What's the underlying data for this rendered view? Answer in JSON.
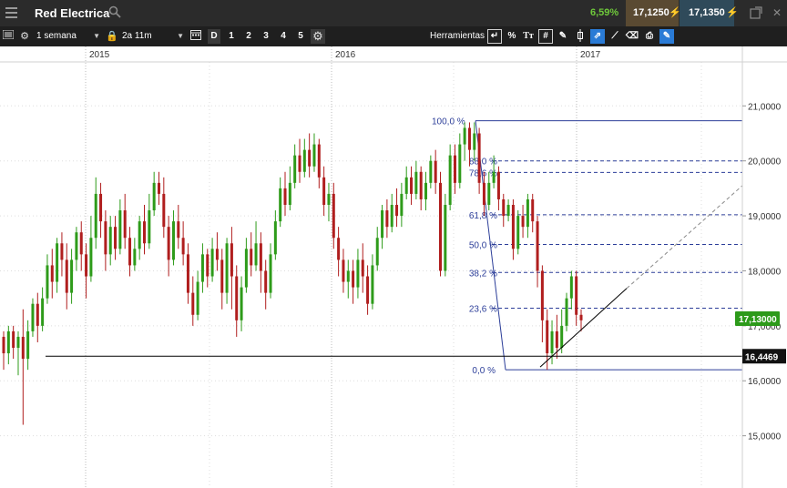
{
  "window": {
    "symbol": "Red Electrica",
    "change_pct": "6,59%",
    "bid": "17,1250",
    "ask": "17,1350"
  },
  "toolbar": {
    "interval": "1 semana",
    "range": "2a 11m",
    "period_buttons": [
      "D",
      "1",
      "2",
      "3",
      "4",
      "5"
    ],
    "tools_label": "Herramientas",
    "pct_tool": "%"
  },
  "chart_data": {
    "type": "candlestick",
    "x_labels": [
      "2015",
      "2016",
      "2017"
    ],
    "y_ticks": [
      "21,0000",
      "20,0000",
      "19,0000",
      "18,0000",
      "17,0000",
      "16,0000",
      "15,0000"
    ],
    "y_tick_values": [
      21,
      20,
      19,
      18,
      17,
      16,
      15
    ],
    "ylim": [
      14.05,
      21.8
    ],
    "current_price": "17,13000",
    "horizontal_line_value": "16,4469",
    "fibonacci": {
      "high": 20.73,
      "low": 16.2,
      "levels": [
        {
          "label": "100,0 %",
          "value": 20.73
        },
        {
          "label": "88,0 %",
          "value": 20.0
        },
        {
          "label": "78,6 %",
          "value": 19.79
        },
        {
          "label": "61,8 %",
          "value": 19.02
        },
        {
          "label": "50,0 %",
          "value": 18.48
        },
        {
          "label": "38,2 %",
          "value": 17.97
        },
        {
          "label": "23,6 %",
          "value": 17.32
        },
        {
          "label": "0,0 %",
          "value": 16.2
        }
      ]
    },
    "trendline": {
      "from": 16.25,
      "to": 17.68,
      "extension_to": 19.55
    },
    "candles": [
      [
        16.8,
        16.5,
        16.9,
        16.2
      ],
      [
        16.5,
        16.9,
        17.0,
        16.3
      ],
      [
        16.9,
        16.6,
        17.0,
        16.4
      ],
      [
        16.6,
        16.8,
        16.9,
        16.1
      ],
      [
        16.8,
        16.4,
        17.3,
        15.2
      ],
      [
        16.4,
        16.9,
        17.1,
        16.2
      ],
      [
        16.9,
        17.4,
        17.5,
        16.8
      ],
      [
        17.4,
        17.0,
        17.6,
        16.7
      ],
      [
        17.0,
        17.5,
        17.7,
        16.9
      ],
      [
        17.5,
        18.1,
        18.3,
        17.4
      ],
      [
        18.1,
        17.8,
        18.4,
        17.5
      ],
      [
        17.8,
        18.5,
        18.6,
        17.6
      ],
      [
        18.5,
        18.2,
        18.7,
        17.9
      ],
      [
        18.2,
        17.6,
        18.5,
        17.3
      ],
      [
        17.6,
        18.2,
        18.4,
        17.4
      ],
      [
        18.2,
        18.7,
        18.8,
        18.0
      ],
      [
        18.7,
        18.3,
        18.9,
        18.0
      ],
      [
        18.3,
        17.9,
        18.5,
        17.5
      ],
      [
        17.9,
        18.6,
        19.0,
        17.8
      ],
      [
        18.6,
        19.4,
        19.7,
        18.4
      ],
      [
        19.4,
        18.9,
        19.6,
        18.6
      ],
      [
        18.9,
        18.3,
        19.1,
        18.0
      ],
      [
        18.3,
        18.8,
        19.0,
        18.1
      ],
      [
        18.8,
        18.4,
        19.0,
        18.2
      ],
      [
        18.4,
        19.1,
        19.3,
        18.3
      ],
      [
        19.1,
        18.6,
        19.4,
        18.4
      ],
      [
        18.6,
        18.1,
        18.8,
        17.9
      ],
      [
        18.1,
        18.4,
        18.6,
        18.0
      ],
      [
        18.4,
        18.9,
        19.0,
        18.2
      ],
      [
        18.9,
        18.5,
        19.2,
        18.3
      ],
      [
        18.5,
        19.1,
        19.4,
        18.4
      ],
      [
        19.1,
        19.6,
        19.8,
        19.0
      ],
      [
        19.6,
        19.4,
        19.8,
        19.2
      ],
      [
        19.4,
        18.8,
        19.7,
        18.6
      ],
      [
        18.8,
        18.2,
        19.0,
        17.9
      ],
      [
        18.2,
        18.9,
        19.1,
        18.1
      ],
      [
        18.9,
        18.6,
        19.2,
        18.4
      ],
      [
        18.6,
        18.3,
        18.9,
        18.1
      ],
      [
        18.3,
        17.6,
        18.5,
        17.4
      ],
      [
        17.6,
        17.2,
        17.9,
        17.0
      ],
      [
        17.2,
        17.8,
        18.0,
        17.1
      ],
      [
        17.8,
        18.3,
        18.5,
        17.6
      ],
      [
        18.3,
        17.9,
        18.4,
        17.7
      ],
      [
        17.9,
        18.4,
        18.6,
        17.8
      ],
      [
        18.4,
        18.2,
        18.7,
        18.0
      ],
      [
        18.2,
        17.6,
        18.4,
        17.3
      ],
      [
        17.6,
        18.5,
        18.6,
        17.4
      ],
      [
        18.5,
        17.9,
        18.8,
        17.3
      ],
      [
        17.9,
        17.1,
        18.1,
        16.8
      ],
      [
        17.1,
        17.7,
        17.9,
        16.9
      ],
      [
        17.7,
        18.4,
        18.6,
        17.6
      ],
      [
        18.4,
        18.1,
        18.7,
        17.9
      ],
      [
        18.1,
        18.5,
        18.9,
        18.0
      ],
      [
        18.5,
        18.0,
        18.7,
        17.6
      ],
      [
        18.0,
        17.6,
        18.2,
        17.3
      ],
      [
        17.6,
        18.3,
        18.5,
        17.5
      ],
      [
        18.3,
        18.9,
        19.1,
        18.2
      ],
      [
        18.9,
        19.5,
        19.7,
        18.8
      ],
      [
        19.5,
        19.2,
        19.8,
        19.0
      ],
      [
        19.2,
        19.6,
        19.9,
        19.1
      ],
      [
        19.6,
        20.1,
        20.3,
        19.5
      ],
      [
        20.1,
        19.8,
        20.4,
        19.6
      ],
      [
        19.8,
        20.2,
        20.4,
        19.7
      ],
      [
        20.2,
        19.9,
        20.5,
        19.7
      ],
      [
        19.9,
        20.3,
        20.5,
        19.8
      ],
      [
        20.3,
        19.7,
        20.4,
        19.5
      ],
      [
        19.7,
        19.2,
        19.9,
        19.0
      ],
      [
        19.2,
        19.4,
        19.6,
        18.9
      ],
      [
        19.4,
        18.6,
        19.6,
        18.4
      ],
      [
        18.6,
        18.2,
        18.8,
        17.9
      ],
      [
        18.2,
        17.8,
        18.4,
        17.6
      ],
      [
        17.8,
        18.0,
        18.2,
        17.5
      ],
      [
        18.0,
        17.7,
        18.2,
        17.4
      ],
      [
        17.7,
        18.2,
        18.4,
        17.5
      ],
      [
        18.2,
        17.9,
        18.5,
        17.6
      ],
      [
        17.9,
        17.4,
        18.1,
        17.2
      ],
      [
        17.4,
        18.1,
        18.3,
        17.3
      ],
      [
        18.1,
        18.6,
        18.8,
        18.0
      ],
      [
        18.6,
        19.1,
        19.2,
        18.4
      ],
      [
        19.1,
        18.8,
        19.3,
        18.6
      ],
      [
        18.8,
        19.2,
        19.4,
        18.7
      ],
      [
        19.2,
        19.0,
        19.5,
        18.8
      ],
      [
        19.0,
        19.4,
        19.6,
        18.8
      ],
      [
        19.4,
        19.7,
        19.9,
        19.3
      ],
      [
        19.7,
        19.4,
        19.9,
        19.2
      ],
      [
        19.4,
        19.8,
        20.0,
        19.3
      ],
      [
        19.8,
        19.3,
        19.9,
        19.1
      ],
      [
        19.3,
        19.6,
        19.8,
        19.1
      ],
      [
        19.6,
        20.0,
        20.1,
        19.5
      ],
      [
        20.0,
        19.6,
        20.2,
        19.4
      ],
      [
        19.6,
        18.0,
        19.8,
        17.9
      ],
      [
        18.0,
        19.2,
        19.4,
        17.9
      ],
      [
        19.2,
        20.1,
        20.3,
        19.1
      ],
      [
        20.1,
        19.6,
        20.3,
        19.4
      ],
      [
        19.6,
        20.3,
        20.5,
        19.5
      ],
      [
        20.3,
        20.6,
        20.7,
        20.0
      ],
      [
        20.6,
        20.2,
        20.7,
        19.9
      ],
      [
        20.2,
        20.5,
        20.7,
        20.0
      ],
      [
        20.5,
        19.6,
        20.6,
        19.4
      ],
      [
        19.6,
        19.2,
        19.8,
        19.0
      ],
      [
        19.2,
        19.6,
        19.8,
        19.1
      ],
      [
        19.6,
        19.8,
        20.1,
        19.5
      ],
      [
        19.8,
        19.3,
        19.9,
        19.1
      ],
      [
        19.3,
        19.0,
        19.4,
        18.8
      ],
      [
        19.0,
        19.2,
        19.3,
        18.9
      ],
      [
        19.2,
        18.4,
        19.3,
        18.2
      ],
      [
        18.4,
        19.0,
        19.1,
        18.3
      ],
      [
        19.0,
        18.8,
        19.2,
        18.6
      ],
      [
        18.8,
        19.3,
        19.4,
        18.6
      ],
      [
        19.3,
        18.9,
        19.4,
        18.7
      ],
      [
        18.9,
        18.0,
        19.0,
        17.7
      ],
      [
        18.0,
        17.1,
        18.1,
        16.7
      ],
      [
        17.1,
        16.5,
        17.3,
        16.2
      ],
      [
        16.5,
        16.9,
        17.1,
        16.3
      ],
      [
        16.9,
        16.6,
        17.2,
        16.4
      ],
      [
        16.6,
        17.0,
        17.3,
        16.5
      ],
      [
        17.0,
        17.5,
        17.6,
        16.9
      ],
      [
        17.5,
        17.9,
        18.0,
        17.3
      ],
      [
        17.9,
        17.2,
        18.0,
        17.0
      ],
      [
        17.2,
        17.1,
        17.3,
        16.9
      ]
    ]
  }
}
